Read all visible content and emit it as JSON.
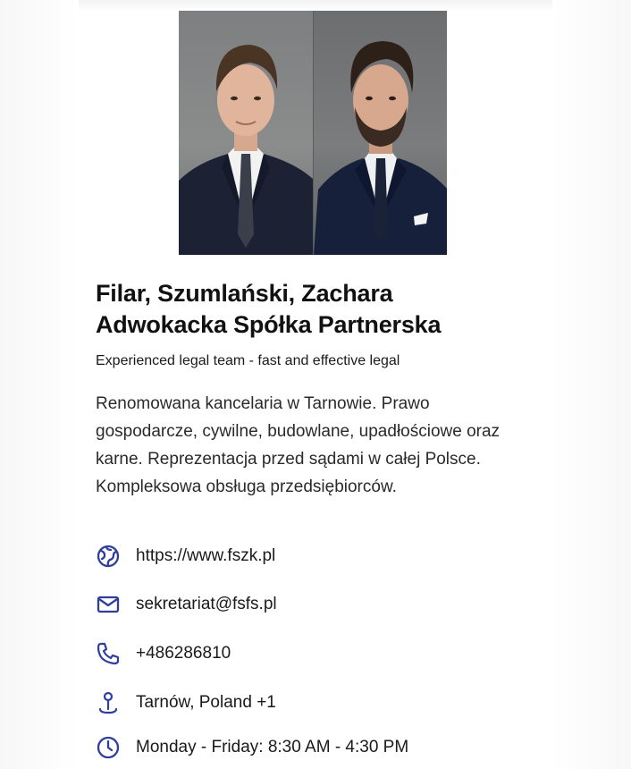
{
  "business": {
    "name_line1": "Filar, Szumlański, Zachara",
    "name_line2": "Adwokacka Spółka Partnerska",
    "tagline": "Experienced legal team - fast and effective legal",
    "description": "Renomowana kancelaria w Tarnowie. Prawo gospodarcze, cywilne, budowlane, upadłościowe oraz karne. Reprezentacja przed sądami w całej Polsce. Kompleksowa obsługa przedsiębiorców."
  },
  "contact": {
    "website": "https://www.fszk.pl",
    "email": "sekretariat@fsfs.pl",
    "phone": "+486286810",
    "location": "Tarnów, Poland +1",
    "hours": "Monday - Friday: 8:30 AM - 4:30 PM"
  },
  "icons": {
    "website": "globe-icon",
    "email": "mail-icon",
    "phone": "phone-icon",
    "location": "map-pin-icon",
    "hours": "clock-icon"
  },
  "colors": {
    "icon_accent": "#2f3e9e",
    "text_primary": "#111111"
  }
}
